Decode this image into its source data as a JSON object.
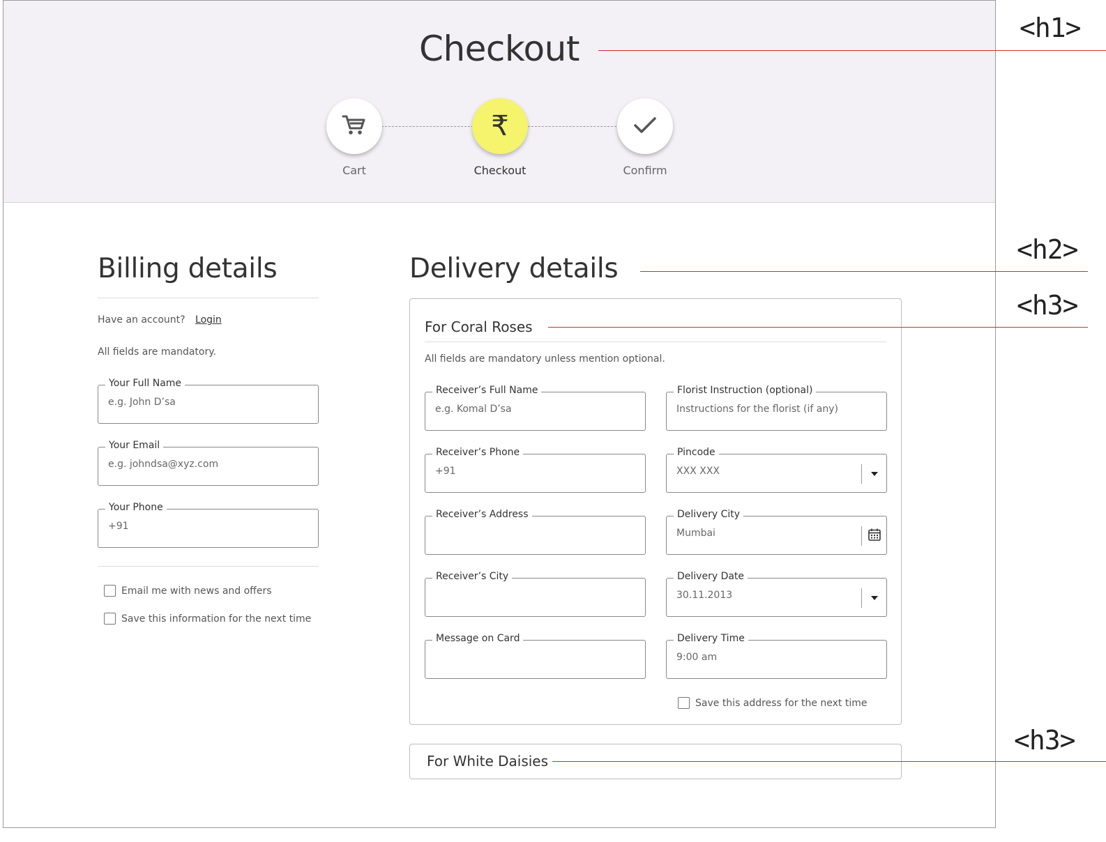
{
  "header": {
    "title": "Checkout",
    "steps": [
      {
        "label": "Cart",
        "icon": "cart-icon"
      },
      {
        "label": "Checkout",
        "icon": "rupee-icon",
        "symbol": "₹"
      },
      {
        "label": "Confirm",
        "icon": "check-icon"
      }
    ],
    "active_color": "#f6f36d"
  },
  "billing": {
    "title": "Billing details",
    "account_prompt": "Have an account?",
    "login_link": "Login",
    "mandatory_note": "All fields are mandatory.",
    "fields": [
      {
        "label": "Your Full Name",
        "placeholder": "e.g. John D’sa"
      },
      {
        "label": "Your Email",
        "placeholder": "e.g. johndsa@xyz.com"
      },
      {
        "label": "Your Phone",
        "placeholder": "+91"
      }
    ],
    "checkboxes": [
      {
        "label": "Email me with news and offers",
        "checked": false
      },
      {
        "label": "Save this information for the next time",
        "checked": false
      }
    ]
  },
  "delivery": {
    "title": "Delivery details",
    "cards": [
      {
        "title": "For Coral Roses",
        "note": "All fields are mandatory unless mention optional.",
        "left_fields": [
          {
            "label": "Receiver’s Full Name",
            "placeholder": "e.g. Komal D’sa"
          },
          {
            "label": "Receiver’s Phone",
            "placeholder": "+91"
          },
          {
            "label": "Receiver’s Address",
            "placeholder": ""
          },
          {
            "label": "Receiver’s City",
            "placeholder": ""
          },
          {
            "label": "Message on Card",
            "placeholder": ""
          }
        ],
        "right_fields": [
          {
            "label": "Florist Instruction (optional)",
            "placeholder": "Instructions for the florist (if any)"
          },
          {
            "label": "Pincode",
            "placeholder": "XXX XXX",
            "adornment": "dropdown"
          },
          {
            "label": "Delivery City",
            "placeholder": "Mumbai",
            "adornment": "calendar"
          },
          {
            "label": "Delivery Date",
            "placeholder": "30.11.2013",
            "adornment": "dropdown"
          },
          {
            "label": "Delivery Time",
            "placeholder": "9:00 am"
          }
        ],
        "save_checkbox": "Save this address for the next time"
      },
      {
        "title": "For White Daisies"
      }
    ]
  },
  "annotations": {
    "h1": "<h1>",
    "h2": "<h2>",
    "h3_a": "<h3>",
    "h3_b": "<h3>",
    "line_color": "#c9302c"
  }
}
